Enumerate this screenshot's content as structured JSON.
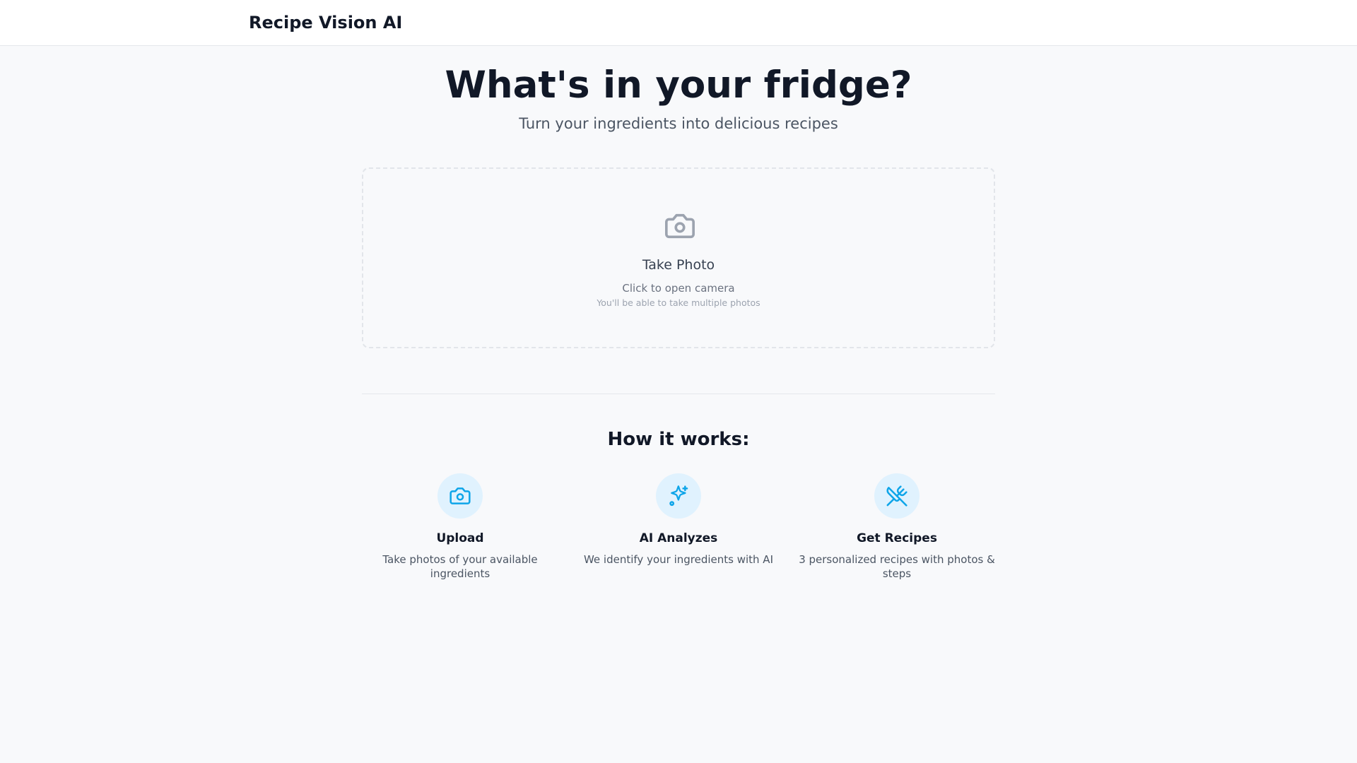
{
  "header": {
    "brand": "Recipe Vision AI"
  },
  "hero": {
    "title": "What's in your fridge?",
    "subtitle": "Turn your ingredients into delicious recipes"
  },
  "upload": {
    "icon": "camera-icon",
    "title": "Take Photo",
    "hint": "Click to open camera",
    "subhint": "You'll be able to take multiple photos"
  },
  "how": {
    "title": "How it works:",
    "steps": [
      {
        "icon": "camera-icon",
        "title": "Upload",
        "desc": "Take photos of your available ingredients"
      },
      {
        "icon": "sparkles-icon",
        "title": "AI Analyzes",
        "desc": "We identify your ingredients with AI"
      },
      {
        "icon": "utensils-crossed-icon",
        "title": "Get Recipes",
        "desc": "3 personalized recipes with photos & steps"
      }
    ]
  },
  "colors": {
    "accent": "#0ea5e9",
    "accent_bg": "#e0f2fe",
    "background": "#f8f9fb"
  }
}
